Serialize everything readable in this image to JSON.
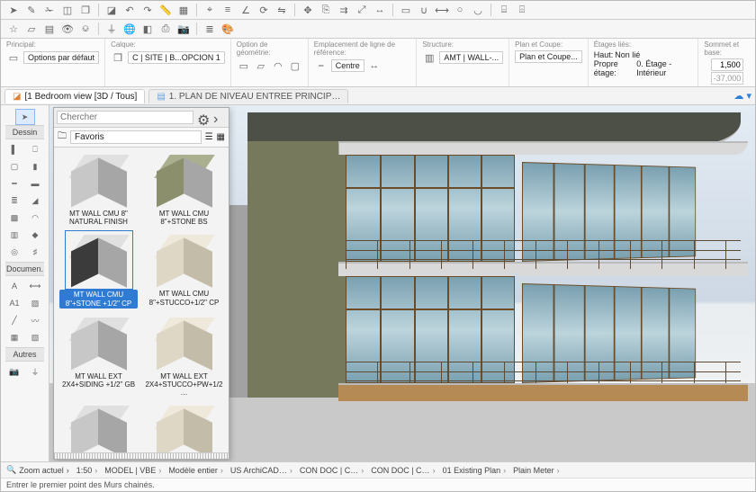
{
  "toolbar1_icons": [
    "pointer",
    "pen",
    "cut",
    "eraser",
    "layers",
    "cube",
    "undo",
    "redo",
    "ruler",
    "grid",
    "snap",
    "align",
    "angle",
    "rotate",
    "mirror",
    "move",
    "copy",
    "offset",
    "scale",
    "stretch",
    "box",
    "join",
    "measure",
    "circle",
    "arc",
    "group",
    "ungroup"
  ],
  "toolbar2_icons": [
    "star",
    "outline",
    "sheet",
    "view",
    "section",
    "elev",
    "globe",
    "3d",
    "print",
    "camera",
    "layers2",
    "palette"
  ],
  "optsbar": {
    "principal": {
      "title": "Principal:",
      "value": "Options par défaut"
    },
    "calque": {
      "title": "Calque:",
      "value": "C | SITE | B...OPCION 1"
    },
    "geom": {
      "title": "Option de géométrie:"
    },
    "refline": {
      "title": "Emplacement de ligne de référence:",
      "value": "Centre"
    },
    "structure": {
      "title": "Structure:",
      "value": "AMT | WALL-..."
    },
    "plan": {
      "title": "Plan et Coupe:",
      "value": "Plan et Coupe..."
    },
    "etages": {
      "title": "Étages liés:",
      "haut_label": "Haut:",
      "haut_val": "Non lié",
      "propre_label": "Propre étage:",
      "propre_val": "0. Étage - Intérieur"
    },
    "sommet": {
      "title": "Sommet et base:",
      "top": "1,500",
      "bot": "-37,000"
    }
  },
  "tabs": [
    {
      "label": "[1 Bedroom view [3D / Tous]",
      "active": true
    },
    {
      "label": "1. PLAN DE NIVEAU ENTREE PRINCIP…",
      "active": false
    }
  ],
  "cloud_indicator": "☁ ▾",
  "toolbox": {
    "arrow": "pointer",
    "sections": [
      {
        "title": "Dessin",
        "tools": [
          "wall",
          "door",
          "window",
          "column",
          "beam",
          "slab",
          "stair",
          "roof",
          "mesh",
          "shell",
          "curtain",
          "morph",
          "object",
          "railing"
        ]
      },
      {
        "title": "Documen.",
        "tools": [
          "text",
          "dim",
          "label",
          "fill",
          "line",
          "spline",
          "zone",
          "hatch"
        ]
      },
      {
        "title": "Autres",
        "tools": [
          "camera",
          "elev"
        ]
      }
    ]
  },
  "panel": {
    "search_placeholder": "Chercher",
    "folder_label": "Favoris",
    "items": [
      {
        "label": "MT WALL CMU 8\" NATURAL FINISH",
        "thumb": {
          "top": "c-grey-l",
          "left": "c-grey",
          "right": "c-grey-d"
        }
      },
      {
        "label": "MT WALL CMU 8\"+STONE BS",
        "thumb": {
          "top": "c-olive-l",
          "left": "c-olive",
          "right": "c-grey-d"
        }
      },
      {
        "label": "MT WALL CMU 8\"+STONE +1/2\" CP",
        "selected": true,
        "thumb": {
          "top": "c-grey-l",
          "left": "c-dark",
          "right": "c-grey-d"
        }
      },
      {
        "label": "MT WALL CMU 8\"+STUCCO+1/2\" CP",
        "thumb": {
          "top": "c-cream-l",
          "left": "c-cream",
          "right": "c-cream-d"
        }
      },
      {
        "label": "MT WALL EXT 2X4+SIDING +1/2\" GB",
        "thumb": {
          "top": "c-grey-l",
          "left": "c-grey",
          "right": "c-grey-d"
        }
      },
      {
        "label": "MT WALL EXT 2X4+STUCCO+PW+1/2 …",
        "thumb": {
          "top": "c-cream-l",
          "left": "c-cream",
          "right": "c-cream-d"
        }
      },
      {
        "label": "",
        "thumb": {
          "top": "c-grey-l",
          "left": "c-grey",
          "right": "c-grey-d"
        }
      },
      {
        "label": "",
        "thumb": {
          "top": "c-cream-l",
          "left": "c-cream",
          "right": "c-cream-d"
        }
      }
    ]
  },
  "statusbar": {
    "zoom_label": "Zoom actuel",
    "zoom_value": "›",
    "scale": "1:50",
    "segments": [
      "MODEL | VBE",
      "Modèle entier",
      "US ArchiCAD…",
      "CON DOC | C…",
      "CON DOC | C…",
      "01 Existing Plan",
      "Plain Meter"
    ]
  },
  "hint": "Entrer le premier point des Murs chainés."
}
